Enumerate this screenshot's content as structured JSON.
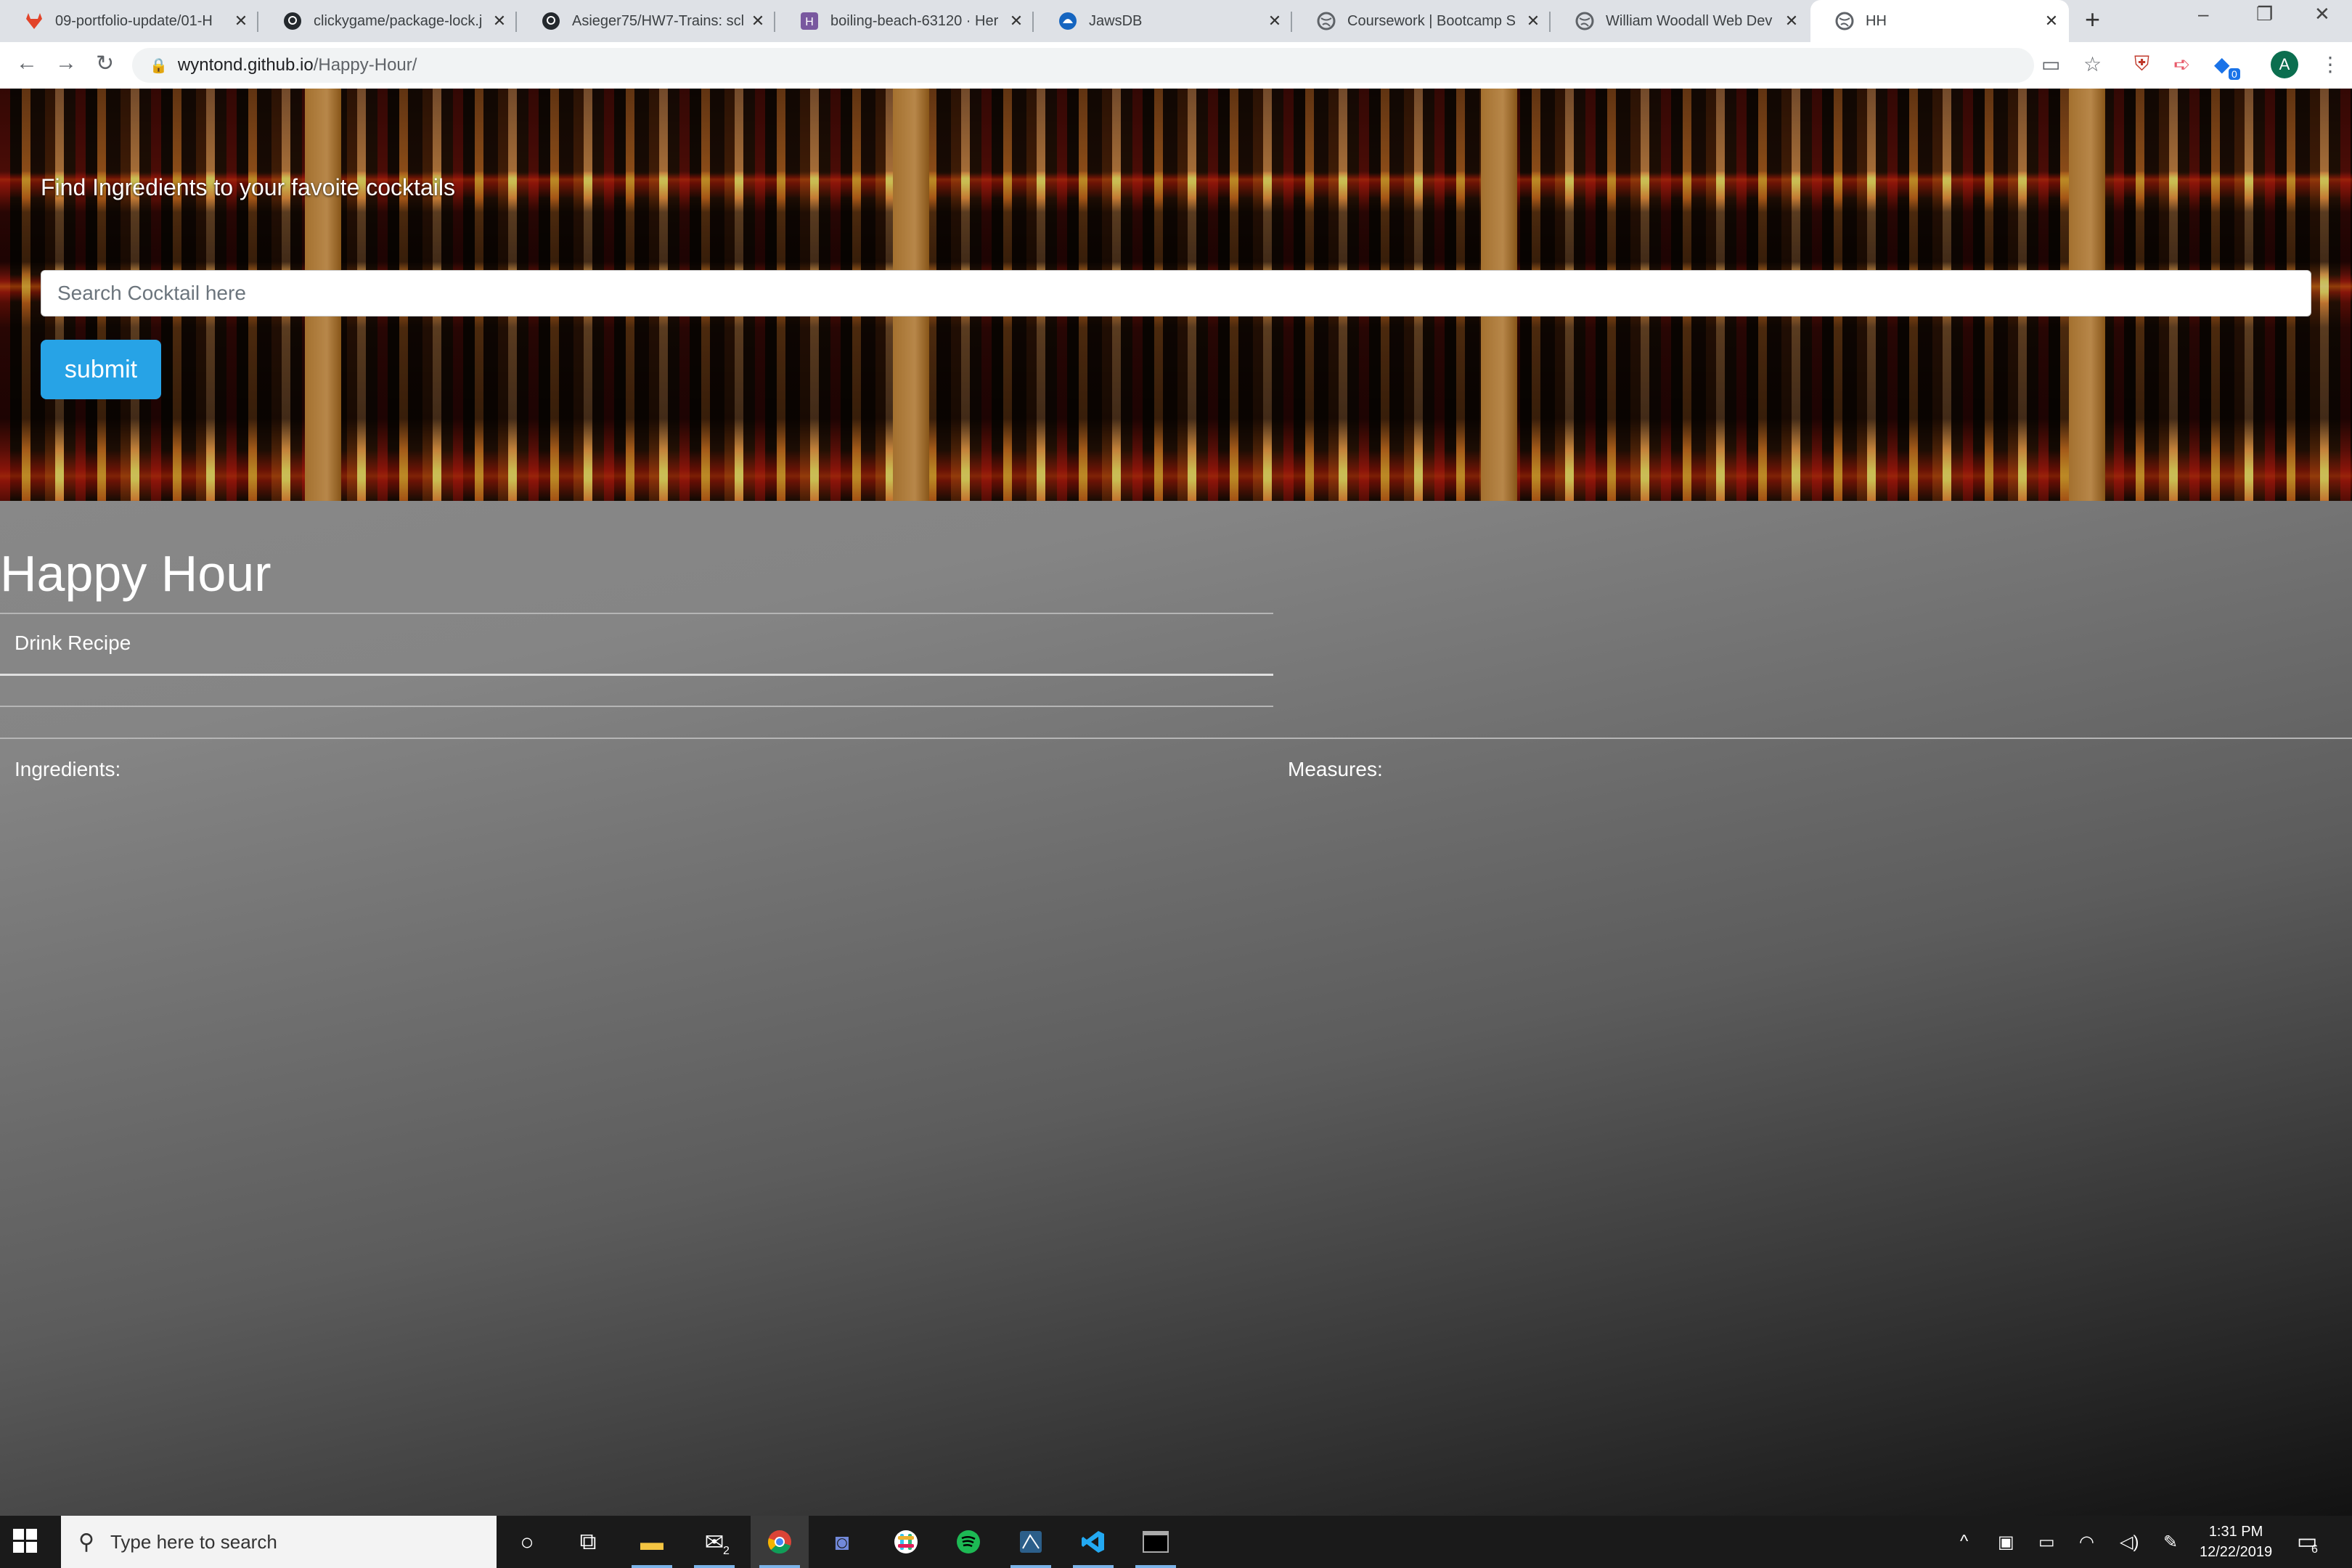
{
  "tabs": [
    {
      "title": "09-portfolio-update/01-H",
      "favicon": "gitlab-icon"
    },
    {
      "title": "clickygame/package-lock.j",
      "favicon": "github-icon"
    },
    {
      "title": "Asieger75/HW7-Trains: scl",
      "favicon": "github-icon"
    },
    {
      "title": "boiling-beach-63120 · Her",
      "favicon": "heroku-icon"
    },
    {
      "title": "JawsDB",
      "favicon": "jawsdb-icon"
    },
    {
      "title": "Coursework | Bootcamp S",
      "favicon": "globe-icon"
    },
    {
      "title": "William Woodall Web Dev",
      "favicon": "globe-icon"
    },
    {
      "title": "HH",
      "favicon": "globe-icon"
    }
  ],
  "active_tab": 7,
  "address": {
    "host": "wyntond.github.io",
    "path": "/Happy-Hour/"
  },
  "profile_initial": "A",
  "extension_badge": "0",
  "hero": {
    "title": "Find Ingredients to your favoite cocktails",
    "search_placeholder": "Search Cocktail here",
    "submit_label": "submit"
  },
  "app": {
    "title": "Happy Hour",
    "recipe_label": "Drink Recipe",
    "ingredients_label": "Ingredients:",
    "measures_label": "Measures:"
  },
  "taskbar": {
    "search_placeholder": "Type here to search",
    "mail_badge": "2",
    "time": "1:31 PM",
    "date": "12/22/2019",
    "notification_count": "6"
  },
  "colors": {
    "submit_button": "#27a3e6",
    "tab_strip": "#dee1e6",
    "taskbar": "#1a1a1a"
  }
}
